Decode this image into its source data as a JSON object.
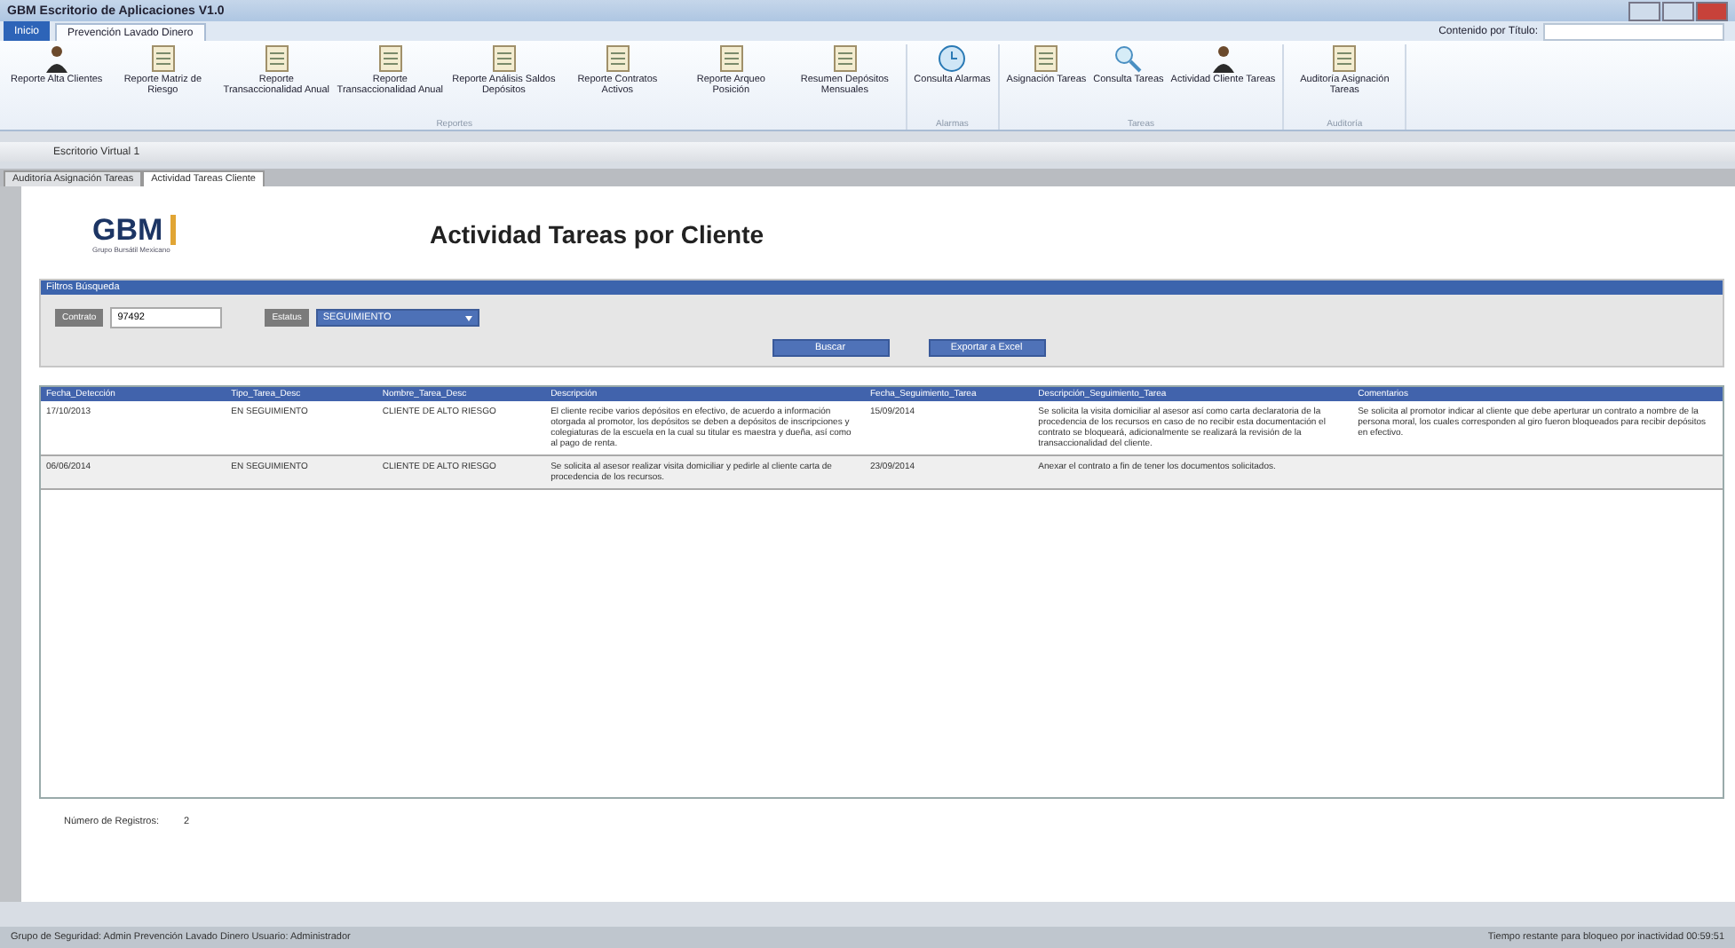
{
  "window": {
    "title": "GBM Escritorio de Aplicaciones V1.0"
  },
  "ribbon_tabs": [
    {
      "label": "Inicio",
      "kind": "file",
      "selected": false
    },
    {
      "label": "Prevención Lavado Dinero",
      "kind": "tab",
      "selected": true
    }
  ],
  "ribbon_search": {
    "label": "Contenido por Título:"
  },
  "ribbon_groups": [
    {
      "label": "Reportes",
      "buttons": [
        {
          "label": "Reporte Alta Clientes",
          "kind": "person"
        },
        {
          "label": "Reporte Matriz de Riesgo",
          "kind": "doc"
        },
        {
          "label": "Reporte Transaccionalidad Anual",
          "kind": "doc"
        },
        {
          "label": "Reporte Transaccionalidad Anual",
          "kind": "doc"
        },
        {
          "label": "Reporte Análisis Saldos Depósitos",
          "kind": "doc"
        },
        {
          "label": "Reporte Contratos Activos",
          "kind": "doc"
        },
        {
          "label": "Reporte Arqueo Posición",
          "kind": "doc"
        },
        {
          "label": "Resumen Depósitos Mensuales",
          "kind": "doc"
        }
      ]
    },
    {
      "label": "Alarmas",
      "buttons": [
        {
          "label": "Consulta Alarmas",
          "kind": "alarm"
        }
      ]
    },
    {
      "label": "Tareas",
      "buttons": [
        {
          "label": "Asignación Tareas",
          "kind": "doc"
        },
        {
          "label": "Consulta Tareas",
          "kind": "search"
        },
        {
          "label": "Actividad Cliente Tareas",
          "kind": "person"
        }
      ]
    },
    {
      "label": "Auditoría",
      "buttons": [
        {
          "label": "Auditoría Asignación Tareas",
          "kind": "doc"
        }
      ]
    }
  ],
  "desktop_bar": {
    "label": "Escritorio Virtual 1"
  },
  "doc_tabs": [
    {
      "label": "Auditoría Asignación Tareas",
      "selected": false
    },
    {
      "label": "Actividad Tareas Cliente",
      "selected": true
    }
  ],
  "logo": {
    "text": "GBM",
    "tagline": "Grupo Bursátil Mexicano"
  },
  "page_title": "Actividad Tareas por Cliente",
  "filters": {
    "title": "Filtros Búsqueda",
    "contract": {
      "label": "Contrato",
      "value": "97492"
    },
    "status": {
      "label": "Estatus",
      "value": "SEGUIMIENTO"
    },
    "buttons": [
      "Buscar",
      "Exportar a Excel"
    ]
  },
  "table": {
    "columns": [
      "Fecha_Detección",
      "Tipo_Tarea_Desc",
      "Nombre_Tarea_Desc",
      "Descripción",
      "Fecha_Seguimiento_Tarea",
      "Descripción_Seguimiento_Tarea",
      "Comentarios"
    ],
    "rows": [
      [
        "17/10/2013",
        "EN SEGUIMIENTO",
        "CLIENTE DE ALTO RIESGO",
        "El cliente recibe varios depósitos en efectivo, de acuerdo a información otorgada al promotor, los depósitos se deben a depósitos de inscripciones y colegiaturas de la escuela en la cual su titular es maestra y dueña, así como al pago de renta.",
        "15/09/2014",
        "Se solicita la visita domiciliar al asesor así como carta declaratoria de la procedencia de los recursos en caso de no recibir esta documentación el contrato se bloqueará, adicionalmente se realizará la revisión de la transaccionalidad del cliente.",
        "Se solicita al promotor indicar al cliente que debe aperturar un contrato a nombre de la persona moral, los cuales corresponden al giro fueron bloqueados para recibir depósitos en efectivo."
      ],
      [
        "06/06/2014",
        "EN SEGUIMIENTO",
        "CLIENTE DE ALTO RIESGO",
        "Se solicita al asesor realizar visita domiciliar y pedirle al cliente carta de procedencia de los recursos.",
        "23/09/2014",
        "Anexar el contrato a fin de tener los documentos solicitados.",
        ""
      ]
    ]
  },
  "record_count": {
    "label": "Número de Registros:",
    "value": "2"
  },
  "status_bar": {
    "left": "Grupo de Seguridad: Admin Prevención Lavado Dinero Usuario: Administrador",
    "right": "Tiempo restante para bloqueo por inactividad 00:59:51"
  }
}
